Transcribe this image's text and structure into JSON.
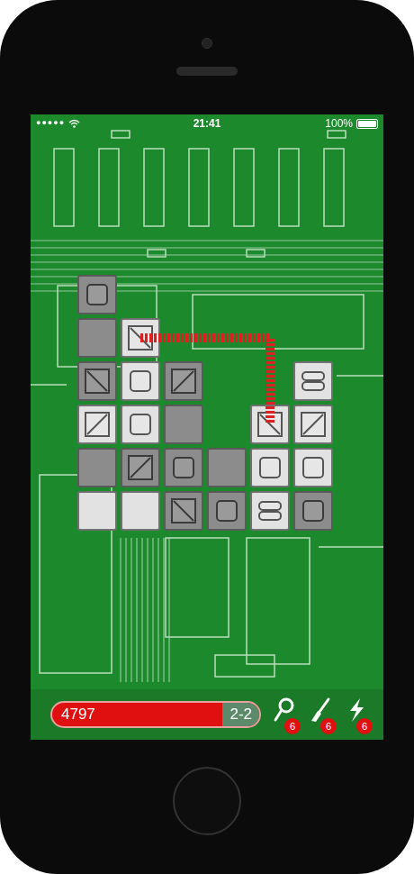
{
  "status_bar": {
    "signal": "●●●●●",
    "time": "21:41",
    "battery": "100%"
  },
  "board": {
    "rows": [
      [
        {
          "kind": "square",
          "lit": false
        },
        {
          "kind": "empty",
          "lit": false
        },
        {
          "kind": "empty",
          "lit": false
        },
        {
          "kind": "empty",
          "lit": false
        },
        {
          "kind": "empty",
          "lit": false
        },
        {
          "kind": "empty",
          "lit": false
        }
      ],
      [
        {
          "kind": "plain",
          "lit": false
        },
        {
          "kind": "backslash",
          "lit": true
        },
        {
          "kind": "empty",
          "lit": false
        },
        {
          "kind": "empty",
          "lit": false
        },
        {
          "kind": "empty",
          "lit": false
        },
        {
          "kind": "empty",
          "lit": false
        }
      ],
      [
        {
          "kind": "backslash",
          "lit": false
        },
        {
          "kind": "square",
          "lit": true
        },
        {
          "kind": "slash",
          "lit": false
        },
        {
          "kind": "empty",
          "lit": false
        },
        {
          "kind": "empty",
          "lit": false
        },
        {
          "kind": "bars",
          "lit": true
        }
      ],
      [
        {
          "kind": "slash",
          "lit": true
        },
        {
          "kind": "square",
          "lit": true
        },
        {
          "kind": "plain",
          "lit": false
        },
        {
          "kind": "empty",
          "lit": false
        },
        {
          "kind": "backslash",
          "lit": true
        },
        {
          "kind": "slash",
          "lit": true
        }
      ],
      [
        {
          "kind": "plain",
          "lit": false
        },
        {
          "kind": "slash",
          "lit": false
        },
        {
          "kind": "square",
          "lit": false
        },
        {
          "kind": "plain",
          "lit": false
        },
        {
          "kind": "square",
          "lit": true
        },
        {
          "kind": "square",
          "lit": true
        }
      ],
      [
        {
          "kind": "plain",
          "lit": true
        },
        {
          "kind": "plain",
          "lit": true
        },
        {
          "kind": "backslash",
          "lit": false
        },
        {
          "kind": "square",
          "lit": false
        },
        {
          "kind": "bars",
          "lit": true
        },
        {
          "kind": "square",
          "lit": false
        }
      ]
    ],
    "wire": [
      [
        1,
        1
      ],
      [
        1,
        4
      ],
      [
        3,
        4
      ]
    ]
  },
  "score_bar": {
    "score": "4797",
    "level": "2-2"
  },
  "powerups": [
    {
      "name": "magnifier",
      "count": "6"
    },
    {
      "name": "brush",
      "count": "6"
    },
    {
      "name": "lightning",
      "count": "6"
    }
  ]
}
